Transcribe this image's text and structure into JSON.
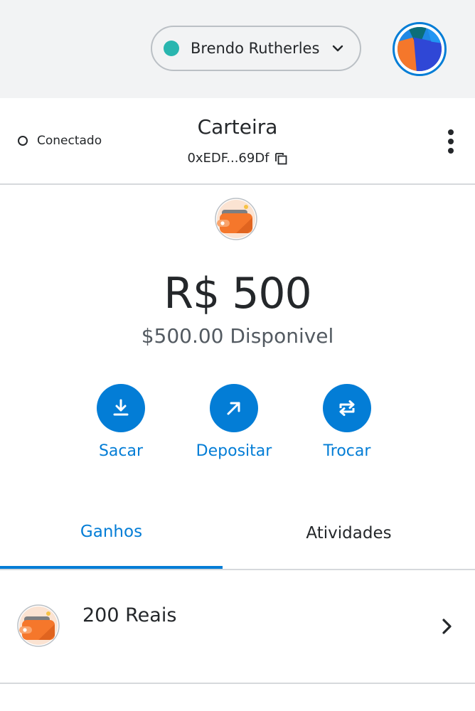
{
  "colors": {
    "accent": "#037dd6",
    "network_dot": "#29b6af",
    "text_primary": "#24272a",
    "text_secondary": "#535a61",
    "topbar_bg": "#f2f3f4",
    "divider": "#d6d9dc",
    "wallet_orange": "#f5772b"
  },
  "topbar": {
    "account_name": "Brendo Rutherles",
    "dropdown_icon": "chevron-down-icon",
    "avatar_icon": "identicon-avatar"
  },
  "header": {
    "connection_status": "Conectado",
    "title": "Carteira",
    "address": "0xEDF...69Df",
    "copy_icon": "copy-icon",
    "menu_icon": "kebab-menu-icon"
  },
  "balance": {
    "token_icon": "wallet-icon",
    "primary": "R$ 500",
    "secondary": "$500.00 Disponivel"
  },
  "actions": [
    {
      "label": "Sacar",
      "icon": "download-icon"
    },
    {
      "label": "Depositar",
      "icon": "arrow-up-right-icon"
    },
    {
      "label": "Trocar",
      "icon": "swap-icon"
    }
  ],
  "tabs": [
    {
      "label": "Ganhos",
      "active": true
    },
    {
      "label": "Atividades",
      "active": false
    }
  ],
  "assets": [
    {
      "label": "200 Reais",
      "icon": "wallet-icon",
      "chevron": "chevron-right-icon"
    }
  ]
}
